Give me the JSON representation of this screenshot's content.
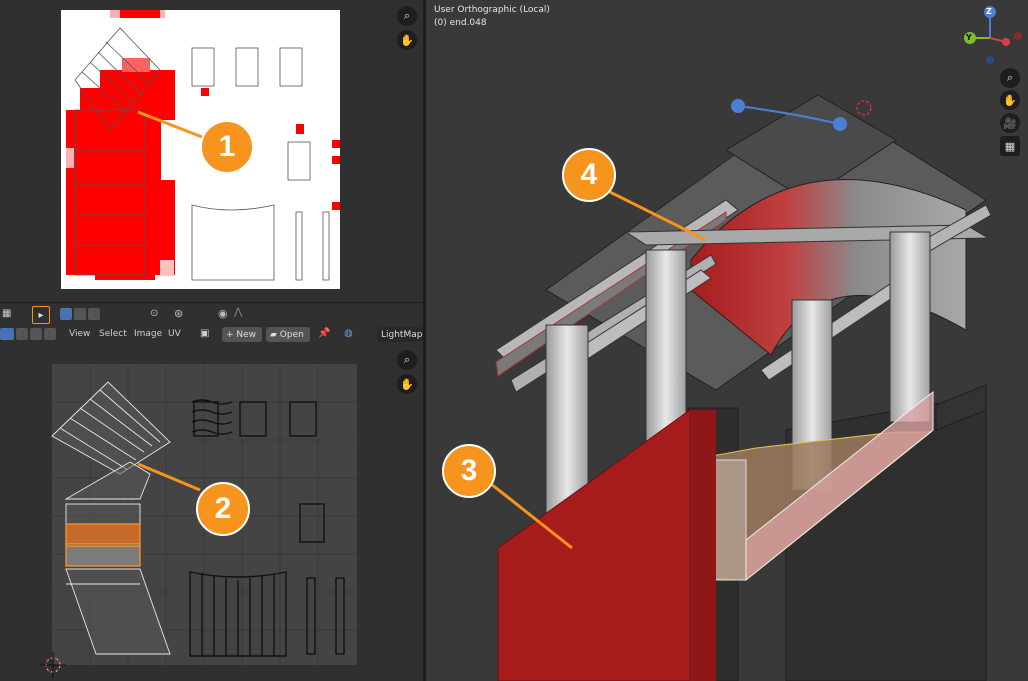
{
  "viewport": {
    "view_name": "User Orthographic (Local)",
    "object_name": "(0) end.048"
  },
  "uv_header": {
    "menus": [
      "View",
      "Select",
      "Image",
      "UV"
    ],
    "new_label": "New",
    "open_label": "Open",
    "image_name": "LightMap"
  },
  "gizmo": {
    "z_label": "Z",
    "y_label": "Y"
  },
  "callouts": [
    "1",
    "2",
    "3",
    "4"
  ],
  "colors": {
    "bake_red": "#ff0000",
    "callout_orange": "#f7941d",
    "mesh_red": "#a61c1c"
  }
}
